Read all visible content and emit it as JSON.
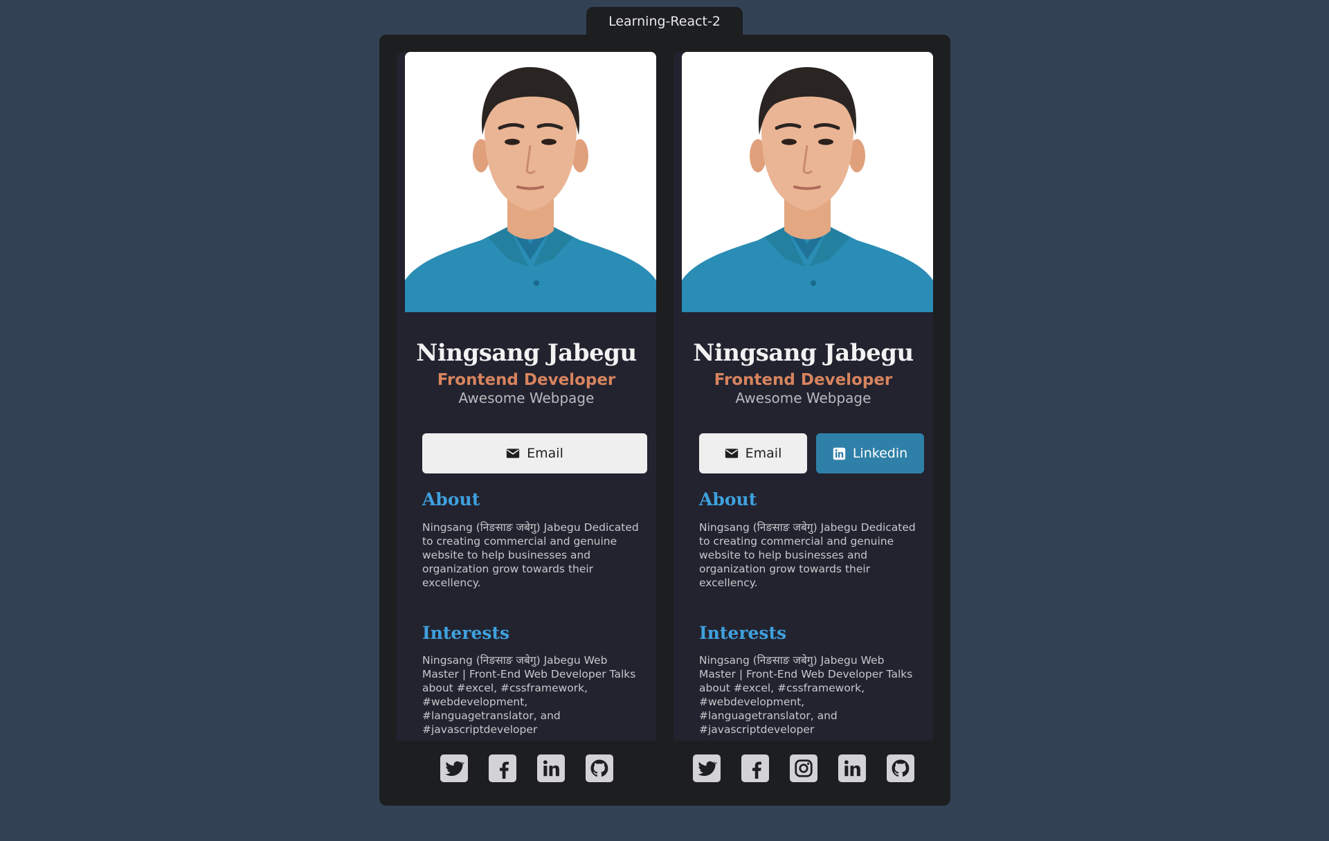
{
  "app_tab": {
    "title": "Learning-React-2"
  },
  "cards": [
    {
      "name": "Ningsang Jabegu",
      "role": "Frontend Developer",
      "tagline": "Awesome Webpage",
      "buttons": {
        "email": "Email"
      },
      "about": {
        "title": "About",
        "text": "Ningsang (निङसाङ जबेगु) Jabegu Dedicated to creating commercial and genuine website to help businesses and organization grow towards their excellency."
      },
      "interests": {
        "title": "Interests",
        "text": "Ningsang (निङसाङ जबेगु) Jabegu Web Master | Front-End Web Developer Talks about #excel, #cssframework, #webdevelopment, #languagetranslator, and #javascriptdeveloper"
      },
      "social_icons": [
        "twitter-icon",
        "facebook-icon",
        "linkedin-icon",
        "github-icon"
      ]
    },
    {
      "name": "Ningsang Jabegu",
      "role": "Frontend Developer",
      "tagline": "Awesome Webpage",
      "buttons": {
        "email": "Email",
        "linkedin": "Linkedin"
      },
      "about": {
        "title": "About",
        "text": "Ningsang (निङसाङ जबेगु) Jabegu Dedicated to creating commercial and genuine website to help businesses and organization grow towards their excellency."
      },
      "interests": {
        "title": "Interests",
        "text": "Ningsang (निङसाङ जबेगु) Jabegu Web Master | Front-End Web Developer Talks about #excel, #cssframework, #webdevelopment, #languagetranslator, and #javascriptdeveloper"
      },
      "social_icons": [
        "twitter-icon",
        "facebook-icon",
        "instagram-icon",
        "linkedin-icon",
        "github-icon"
      ]
    }
  ],
  "colors": {
    "page_background": "#324254",
    "frame": "#1d1e20",
    "card": "#22232f",
    "accent_role": "#d8845e",
    "accent_heading": "#3fa1df",
    "linkedin_button": "#2f80a8"
  }
}
